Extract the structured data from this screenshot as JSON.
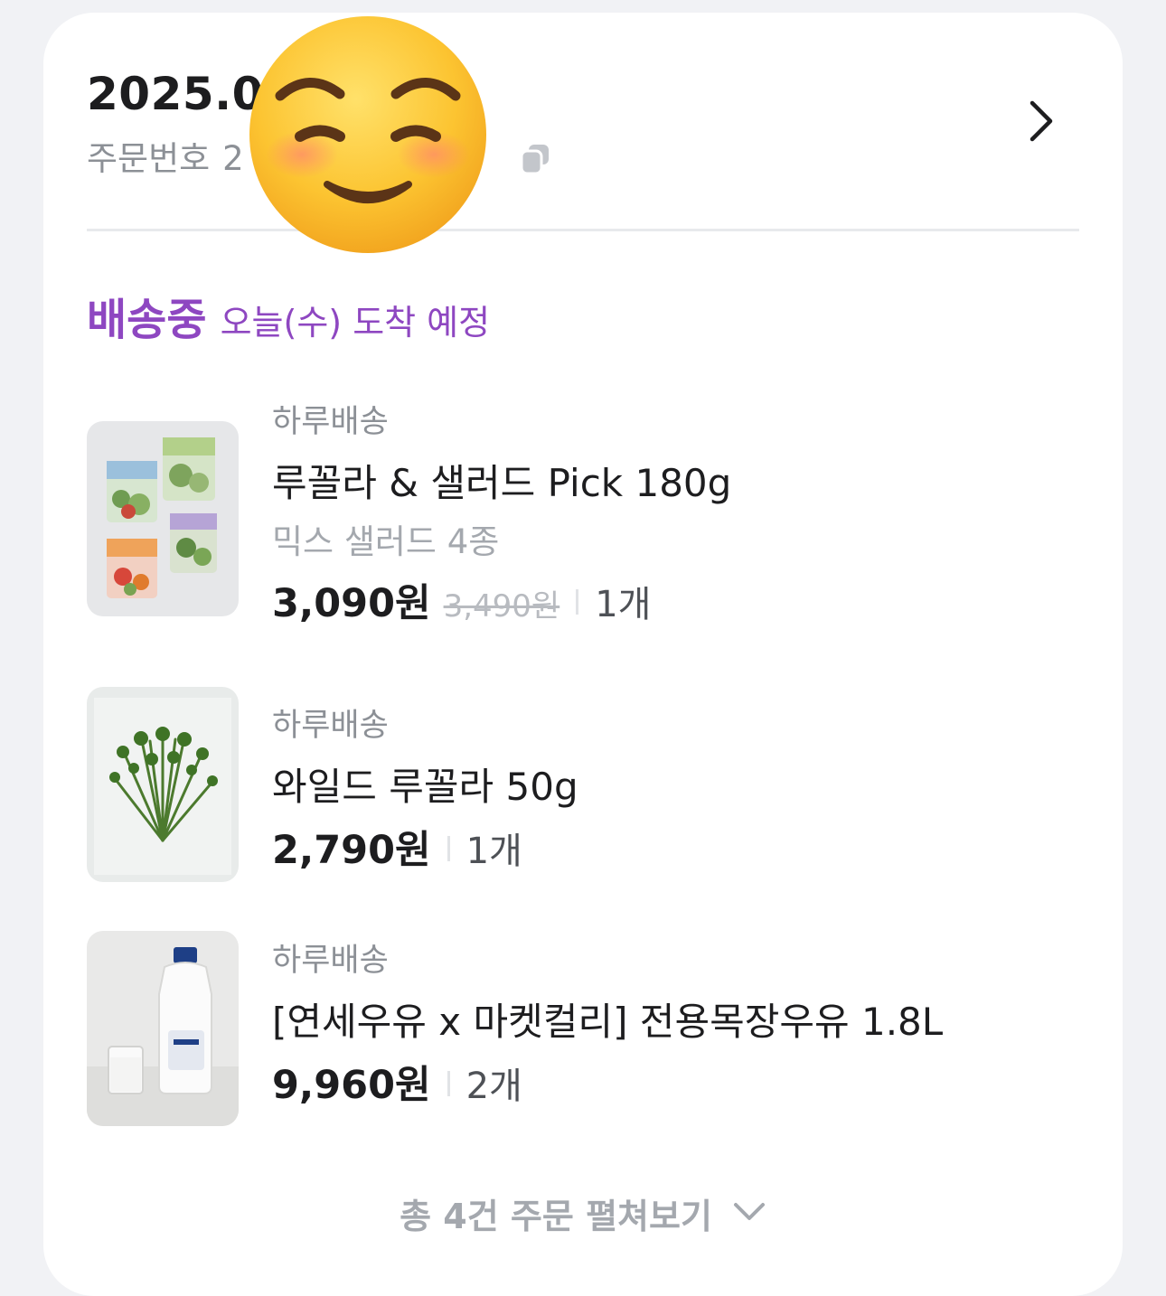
{
  "order": {
    "date": "2025.02",
    "number_label": "주문번호",
    "number_value": "2",
    "number_suffix": "1"
  },
  "icons": {
    "copy": "copy-icon",
    "detail": "chevron-right-icon",
    "expand": "chevron-down-icon",
    "overlay": "smiling-face-emoji-icon"
  },
  "status": {
    "label": "배송중",
    "eta": "오늘(수) 도착 예정"
  },
  "items": [
    {
      "delivery_type": "하루배송",
      "name": "루꼴라 & 샐러드 Pick 180g",
      "option": "믹스 샐러드 4종",
      "price": "3,090원",
      "original_price": "3,490원",
      "quantity": "1개"
    },
    {
      "delivery_type": "하루배송",
      "name": "와일드 루꼴라 50g",
      "price": "2,790원",
      "quantity": "1개"
    },
    {
      "delivery_type": "하루배송",
      "name": "[연세우유 x 마켓컬리] 전용목장우유 1.8L",
      "price": "9,960원",
      "quantity": "2개"
    }
  ],
  "expand": {
    "label": "총 4건 주문 펼쳐보기"
  },
  "colors": {
    "accent": "#8e47c1",
    "text_primary": "#1d1d1f",
    "text_secondary": "#8c9096",
    "background": "#f1f2f5"
  }
}
